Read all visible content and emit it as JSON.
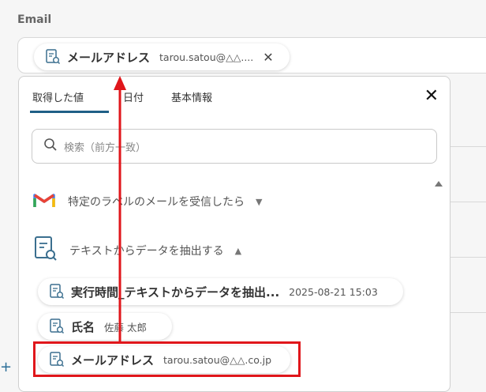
{
  "field": {
    "label": "Email",
    "chip": {
      "label": "メールアドレス",
      "value": "tarou.satou@△△...."
    }
  },
  "panel": {
    "tabs": [
      {
        "label": "取得した値",
        "active": true
      },
      {
        "label": "日付",
        "active": false
      },
      {
        "label": "基本情報",
        "active": false
      }
    ],
    "search_placeholder": "検索（前方一致）",
    "sections": [
      {
        "icon": "gmail-icon",
        "title": "特定のラベルのメールを受信したら",
        "chevron": "down"
      },
      {
        "icon": "document-search-icon",
        "title": "テキストからデータを抽出する",
        "chevron": "up"
      }
    ],
    "values": [
      {
        "label": "実行時間_テキストからデータを抽出...",
        "value": "2025-08-21 15:03"
      },
      {
        "label": "氏名",
        "value": "佐藤 太郎"
      },
      {
        "label": "メールアドレス",
        "value": "tarou.satou@△△.co.jp"
      }
    ]
  },
  "colors": {
    "accent": "#1f5f86",
    "highlight": "#e0161b",
    "arrow": "#e0161b"
  }
}
